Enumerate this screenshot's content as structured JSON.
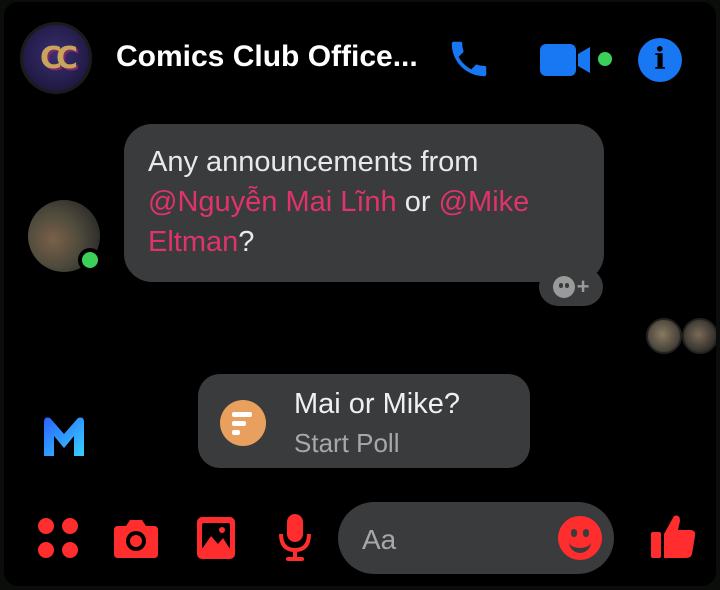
{
  "header": {
    "title": "Comics Club Office...",
    "group_avatar_initials": "CC",
    "icons": [
      "phone-icon",
      "video-camera-icon",
      "info-icon"
    ],
    "active_status": "online"
  },
  "message": {
    "text_before": "Any announcements from ",
    "mention_1": "@Nguyễn Mai Lĩnh",
    "text_mid": " or ",
    "mention_2": "@Mike Eltman",
    "text_after": "?",
    "sender_status": "online"
  },
  "poll_suggestion": {
    "title": "Mai or Mike?",
    "subtitle": "Start Poll"
  },
  "composer": {
    "placeholder": "Aa",
    "icons": [
      "apps-icon",
      "camera-icon",
      "gallery-icon",
      "microphone-icon",
      "emoji-icon",
      "thumbs-up-icon"
    ]
  },
  "colors": {
    "accent_blue": "#1877f2",
    "accent_red": "#ff2d2d",
    "mention": "#e0336a",
    "bubble": "#3a3b3c",
    "online": "#3ad05a"
  }
}
